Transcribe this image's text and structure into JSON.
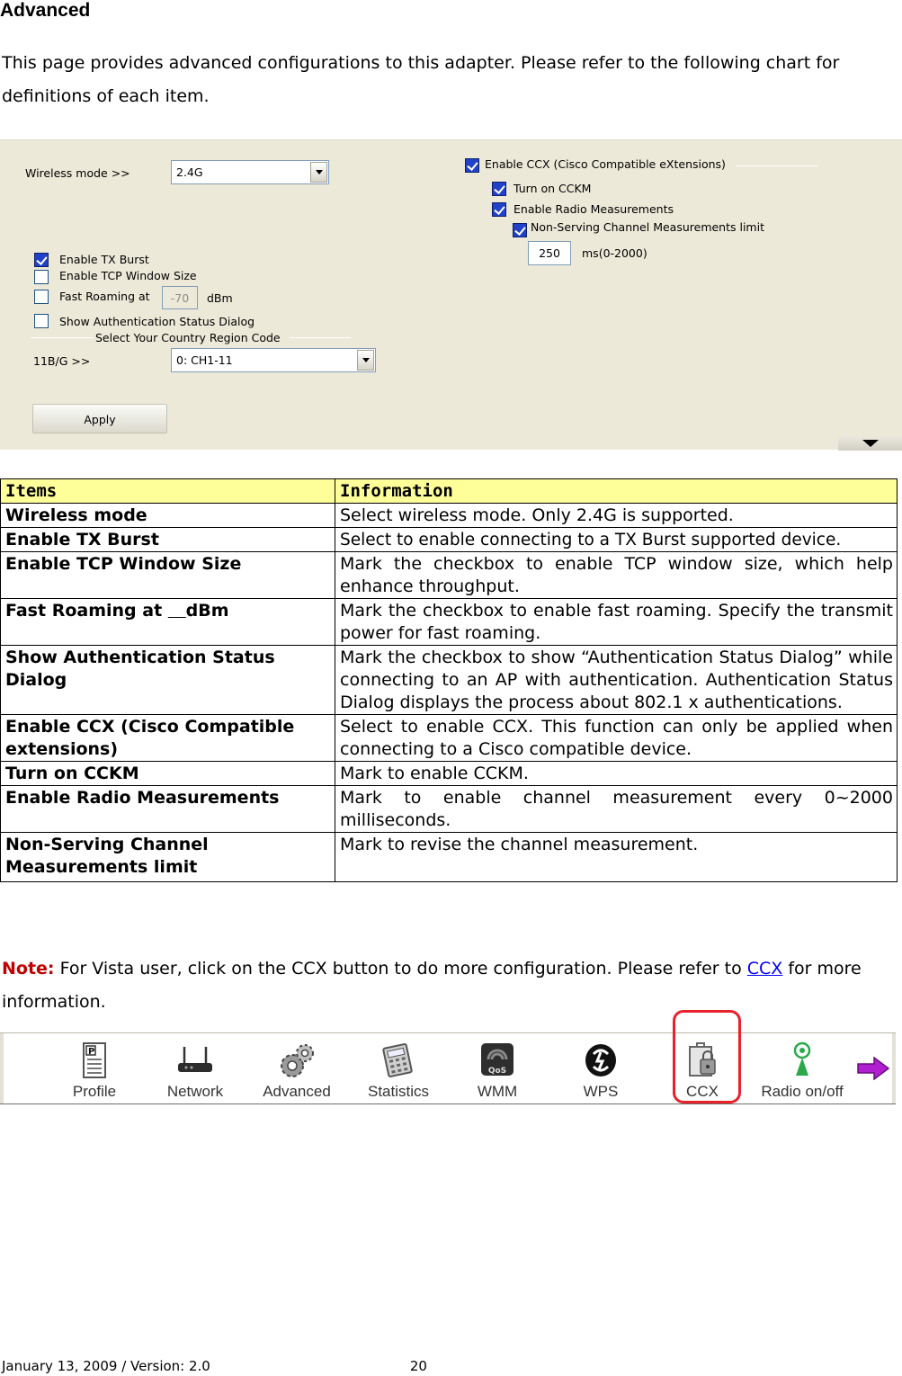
{
  "heading": "Advanced",
  "intro": "This page provides advanced configurations to this adapter. Please refer to the following chart for definitions of each item.",
  "panel": {
    "wireless_mode_label": "Wireless mode >>",
    "wireless_mode_value": "2.4G",
    "enable_tx_burst": {
      "label": "Enable TX Burst",
      "checked": true
    },
    "enable_tcp_window": {
      "label": "Enable TCP Window Size",
      "checked": false
    },
    "fast_roaming": {
      "label": "Fast Roaming at",
      "checked": false,
      "value": "-70",
      "unit": "dBm"
    },
    "show_auth": {
      "label": "Show Authentication Status Dialog",
      "checked": false
    },
    "country_group_label": "Select Your Country Region Code",
    "country_label": "11B/G >>",
    "country_value": "0: CH1-11",
    "apply_label": "Apply",
    "ccx": {
      "label": "Enable CCX (Cisco Compatible eXtensions)",
      "checked": true
    },
    "cckm": {
      "label": "Turn on CCKM",
      "checked": true
    },
    "radio_meas": {
      "label": "Enable Radio Measurements",
      "checked": true
    },
    "non_serving": {
      "label": "Non-Serving Channel Measurements limit",
      "checked": true
    },
    "limit_value": "250",
    "limit_unit": "ms(0-2000)"
  },
  "table": {
    "headers": [
      "Items",
      "Information"
    ],
    "rows": [
      {
        "item": "Wireless mode",
        "info": "Select wireless mode. Only 2.4G is supported."
      },
      {
        "item": "Enable TX Burst",
        "info": "Select to enable connecting to a TX Burst supported device."
      },
      {
        "item": "Enable TCP Window Size",
        "info": "Mark the checkbox to enable TCP window size, which help enhance throughput."
      },
      {
        "item_prefix": "Fast Roaming at ",
        "item_blank": "   ",
        "item_suffix": "dBm",
        "info": "Mark the checkbox to enable fast roaming. Specify the transmit power for fast roaming."
      },
      {
        "item": "Show Authentication Status Dialog",
        "info": "Mark the checkbox to show “Authentication Status Dialog” while connecting to an AP with authentication. Authentication Status Dialog displays the process about 802.1 x authentications."
      },
      {
        "item": "Enable CCX (Cisco Compatible extensions)",
        "info": "Select to enable CCX. This function can only be applied when connecting to a Cisco compatible device."
      },
      {
        "item": "Turn on CCKM",
        "info": "Mark to enable CCKM."
      },
      {
        "item": "Enable Radio Measurements",
        "info": "Mark to enable channel measurement every 0~2000 milliseconds."
      },
      {
        "item": "Non-Serving Channel Measurements limit",
        "info": "Mark to revise the channel measurement."
      }
    ]
  },
  "note": {
    "label": "Note:",
    "text_before": " For Vista user, click on the CCX button to do more configuration. Please refer to ",
    "link": "CCX",
    "text_after": " for more information."
  },
  "toolbar": {
    "items": [
      {
        "label": "Profile",
        "icon": "profile-icon"
      },
      {
        "label": "Network",
        "icon": "network-icon"
      },
      {
        "label": "Advanced",
        "icon": "advanced-icon"
      },
      {
        "label": "Statistics",
        "icon": "statistics-icon"
      },
      {
        "label": "WMM",
        "icon": "wmm-icon"
      },
      {
        "label": "WPS",
        "icon": "wps-icon"
      },
      {
        "label": "CCX",
        "icon": "ccx-icon",
        "highlighted": true
      },
      {
        "label": "Radio on/off",
        "icon": "radio-icon"
      }
    ],
    "wmm_badge": "QoS",
    "highlight_color": "#e8212b"
  },
  "footer": {
    "date_version": "January 13, 2009 / Version: 2.0",
    "page_number": "20"
  }
}
